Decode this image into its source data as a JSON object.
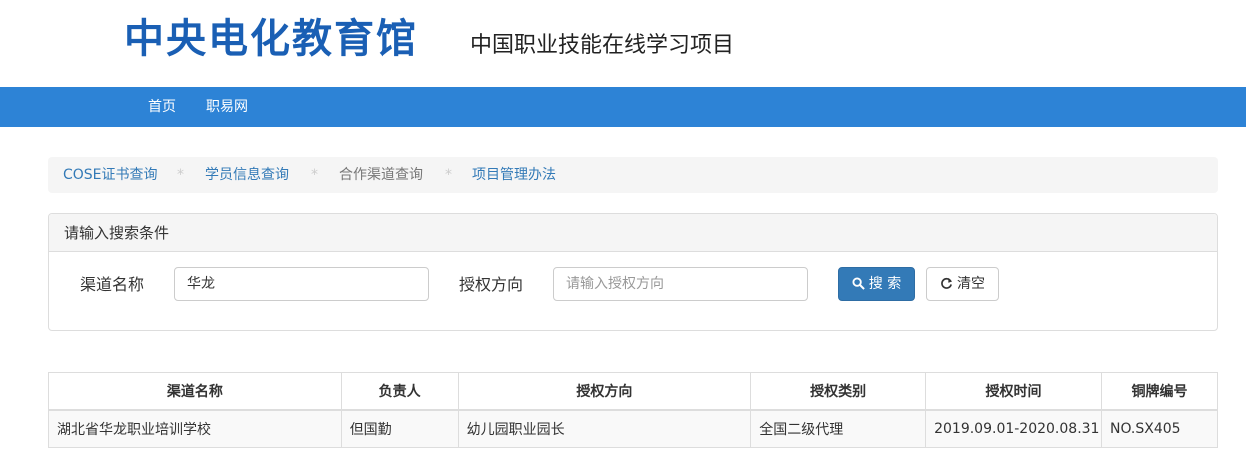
{
  "header": {
    "logo_text": "中央电化教育馆",
    "subtitle": "中国职业技能在线学习项目"
  },
  "nav": {
    "items": [
      {
        "label": "首页"
      },
      {
        "label": "职易网"
      }
    ]
  },
  "breadcrumb": {
    "items": [
      {
        "label": "COSE证书查询"
      },
      {
        "label": "学员信息查询"
      },
      {
        "label": "合作渠道查询"
      },
      {
        "label": "项目管理办法"
      }
    ],
    "separator": "*"
  },
  "search_panel": {
    "heading": "请输入搜索条件",
    "channel_label": "渠道名称",
    "channel_value": "华龙",
    "direction_label": "授权方向",
    "direction_placeholder": "请输入授权方向",
    "search_button": "搜 索",
    "clear_button": "清空"
  },
  "table": {
    "columns": [
      "渠道名称",
      "负责人",
      "授权方向",
      "授权类别",
      "授权时间",
      "铜牌编号"
    ],
    "rows": [
      [
        "湖北省华龙职业培训学校",
        "但国勤",
        "幼儿园职业园长",
        "全国二级代理",
        "2019.09.01-2020.08.31",
        "NO.SX405"
      ]
    ]
  },
  "colors": {
    "brand": "#1a5fb4",
    "navbar": "#2d83d6",
    "primary_button": "#337ab7"
  }
}
